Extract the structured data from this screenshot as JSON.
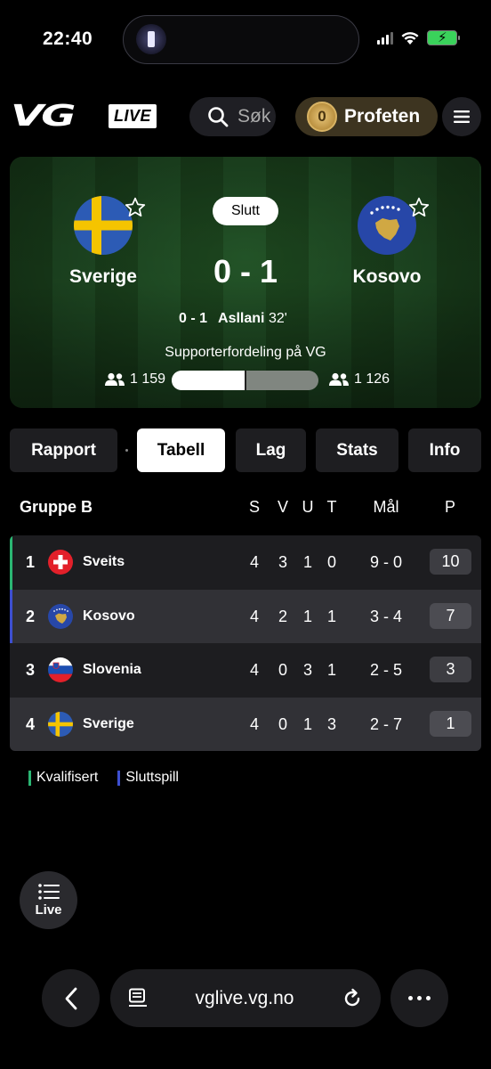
{
  "status_bar": {
    "time": "22:40"
  },
  "header": {
    "logo_vg": "VG",
    "logo_live": "LIVE",
    "search_placeholder": "Søk",
    "profeten_coins": "0",
    "profeten_label": "Profeten"
  },
  "match": {
    "status": "Slutt",
    "home_team": "Sverige",
    "away_team": "Kosovo",
    "score": "0 - 1",
    "goal_score": "0 - 1",
    "goal_scorer": "Asllani",
    "goal_minute": "32'",
    "supporter_title": "Supporterfordeling på VG",
    "home_supporters": "1 159",
    "away_supporters": "1 126",
    "home_supporter_share": 0.507
  },
  "tabs": [
    {
      "label": "Rapport",
      "active": false
    },
    {
      "label": "Tabell",
      "active": true
    },
    {
      "label": "Lag",
      "active": false
    },
    {
      "label": "Stats",
      "active": false
    },
    {
      "label": "Info",
      "active": false
    }
  ],
  "table": {
    "group": "Gruppe B",
    "columns": {
      "s": "S",
      "v": "V",
      "u": "U",
      "t": "T",
      "goals": "Mål",
      "points": "P"
    },
    "rows": [
      {
        "pos": "1",
        "team": "Sveits",
        "s": "4",
        "v": "3",
        "u": "1",
        "t": "0",
        "goals": "9 - 0",
        "points": "10",
        "status": "qualified"
      },
      {
        "pos": "2",
        "team": "Kosovo",
        "s": "4",
        "v": "2",
        "u": "1",
        "t": "1",
        "goals": "3 - 4",
        "points": "7",
        "status": "playoff"
      },
      {
        "pos": "3",
        "team": "Slovenia",
        "s": "4",
        "v": "0",
        "u": "3",
        "t": "1",
        "goals": "2 - 5",
        "points": "3",
        "status": ""
      },
      {
        "pos": "4",
        "team": "Sverige",
        "s": "4",
        "v": "0",
        "u": "1",
        "t": "3",
        "goals": "2 - 7",
        "points": "1",
        "status": ""
      }
    ]
  },
  "legend": {
    "qualified": "Kvalifisert",
    "playoff": "Sluttspill"
  },
  "colors": {
    "qualified": "#2bb673",
    "playoff": "#3d4fd1"
  },
  "live_button": "Live",
  "browser": {
    "url": "vglive.vg.no"
  }
}
